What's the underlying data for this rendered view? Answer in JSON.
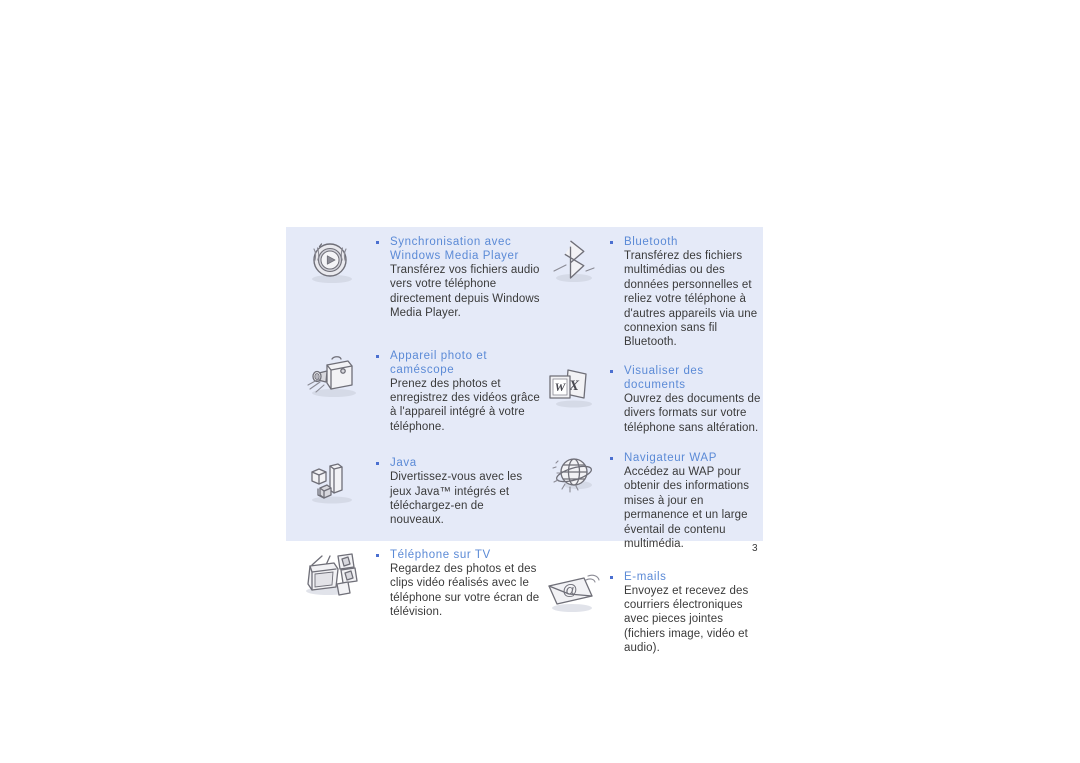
{
  "page": {
    "number": "3",
    "background_color": "#ffffff",
    "panel_color": "#e5eaf8",
    "heading_color": "#5b8ad6",
    "body_text_color": "#3a3a3a",
    "bullet_color": "#4a6fd0"
  },
  "features": {
    "left": [
      {
        "icon": "media-disc-icon",
        "title": "Synchronisation avec Windows Media Player",
        "text": "Transférez vos fichiers audio vers votre téléphone directement depuis Windows Media Player."
      },
      {
        "icon": "camcorder-icon",
        "title": "Appareil photo et caméscope",
        "text": "Prenez des photos et enregistrez des vidéos grâce à l'appareil intégré à votre téléphone."
      },
      {
        "icon": "java-blocks-icon",
        "title": "Java",
        "text": "Divertissez-vous avec les jeux Java™ intégrés et téléchargez-en de nouveaux."
      },
      {
        "icon": "tv-photos-icon",
        "title": "Téléphone sur TV",
        "text": "Regardez des photos et des clips vidéo réalisés avec le téléphone sur votre écran de télévision."
      }
    ],
    "right": [
      {
        "icon": "bluetooth-icon",
        "title": "Bluetooth",
        "text": "Transférez des fichiers multimédias ou des données personnelles et reliez votre téléphone à d'autres appareils via une connexion sans fil Bluetooth."
      },
      {
        "icon": "documents-icon",
        "title": "Visualiser des documents",
        "text": "Ouvrez des documents de divers formats sur votre téléphone sans altération."
      },
      {
        "icon": "globe-wap-icon",
        "title": "Navigateur WAP",
        "text": "Accédez au WAP pour obtenir des informations mises à jour en permanence et un large éventail de contenu multimédia."
      },
      {
        "icon": "email-envelope-icon",
        "title": "E-mails",
        "text": "Envoyez et recevez des courriers électroniques avec pieces jointes (fichiers image, vidéo et audio)."
      }
    ]
  }
}
